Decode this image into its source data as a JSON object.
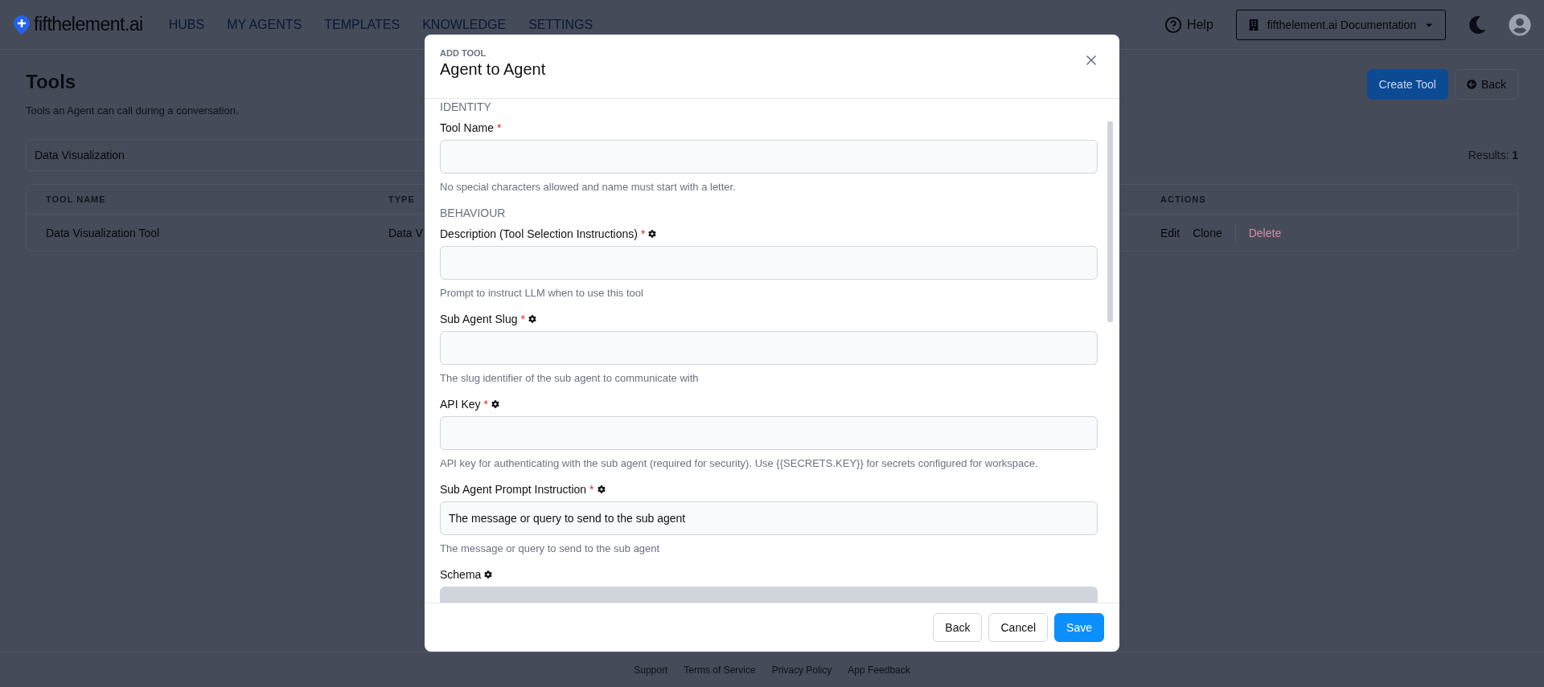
{
  "nav": {
    "logo": "fifthelement.ai",
    "links": [
      "HUBS",
      "MY AGENTS",
      "TEMPLATES",
      "KNOWLEDGE",
      "SETTINGS"
    ],
    "help": "Help",
    "workspace": "fifthelement.ai Documentation"
  },
  "page": {
    "title": "Tools",
    "subtitle": "Tools an Agent can call during a conversation.",
    "buttons": [
      {
        "label": "Create Tool",
        "kind": "primary"
      },
      {
        "label": "Back",
        "kind": "back"
      }
    ],
    "search": {
      "value": "Data Visualization"
    },
    "results_label": "Results:",
    "results_count": "1"
  },
  "table": {
    "columns": [
      "TOOL NAME",
      "TYPE",
      "ACTIONS"
    ],
    "rows": [
      {
        "name": "Data Visualization Tool",
        "type": "Data V",
        "actions": [
          {
            "label": "Edit",
            "kind": "link"
          },
          {
            "label": "Clone",
            "kind": "link"
          },
          {
            "label": "Delete",
            "kind": "danger"
          }
        ]
      }
    ]
  },
  "modal": {
    "eyebrow": "ADD TOOL",
    "title": "Agent to Agent",
    "items": [
      {
        "kind": "section",
        "label": "IDENTITY"
      },
      {
        "kind": "field",
        "label": "Tool Name",
        "required_mark": "*",
        "value": "",
        "help": "No special characters allowed and name must start with a letter."
      },
      {
        "kind": "section",
        "label": "BEHAVIOUR"
      },
      {
        "kind": "field",
        "label": "Description (Tool Selection Instructions)",
        "required_mark": "*",
        "settings": true,
        "value": "",
        "help": "Prompt to instruct LLM when to use this tool"
      },
      {
        "kind": "field",
        "label": "Sub Agent Slug",
        "required_mark": "*",
        "settings": true,
        "value": "",
        "help": "The slug identifier of the sub agent to communicate with"
      },
      {
        "kind": "field",
        "label": "API Key",
        "required_mark": "*",
        "settings": true,
        "value": "",
        "help": "API key for authenticating with the sub agent (required for security). Use {{SECRETS.KEY}} for secrets configured for workspace."
      },
      {
        "kind": "field",
        "label": "Sub Agent Prompt Instruction",
        "required_mark": "*",
        "settings": true,
        "value": "The message or query to send to the sub agent",
        "help": "The message or query to send to the sub agent"
      },
      {
        "kind": "editor",
        "label": "Schema",
        "settings": true,
        "disabled": true
      }
    ],
    "buttons": [
      {
        "label": "Back",
        "kind": "secondary"
      },
      {
        "label": "Cancel",
        "kind": "secondary"
      },
      {
        "label": "Save",
        "kind": "primary"
      }
    ]
  },
  "footer": [
    "Support",
    "Terms of Service",
    "Privacy Policy",
    "App Feedback"
  ]
}
